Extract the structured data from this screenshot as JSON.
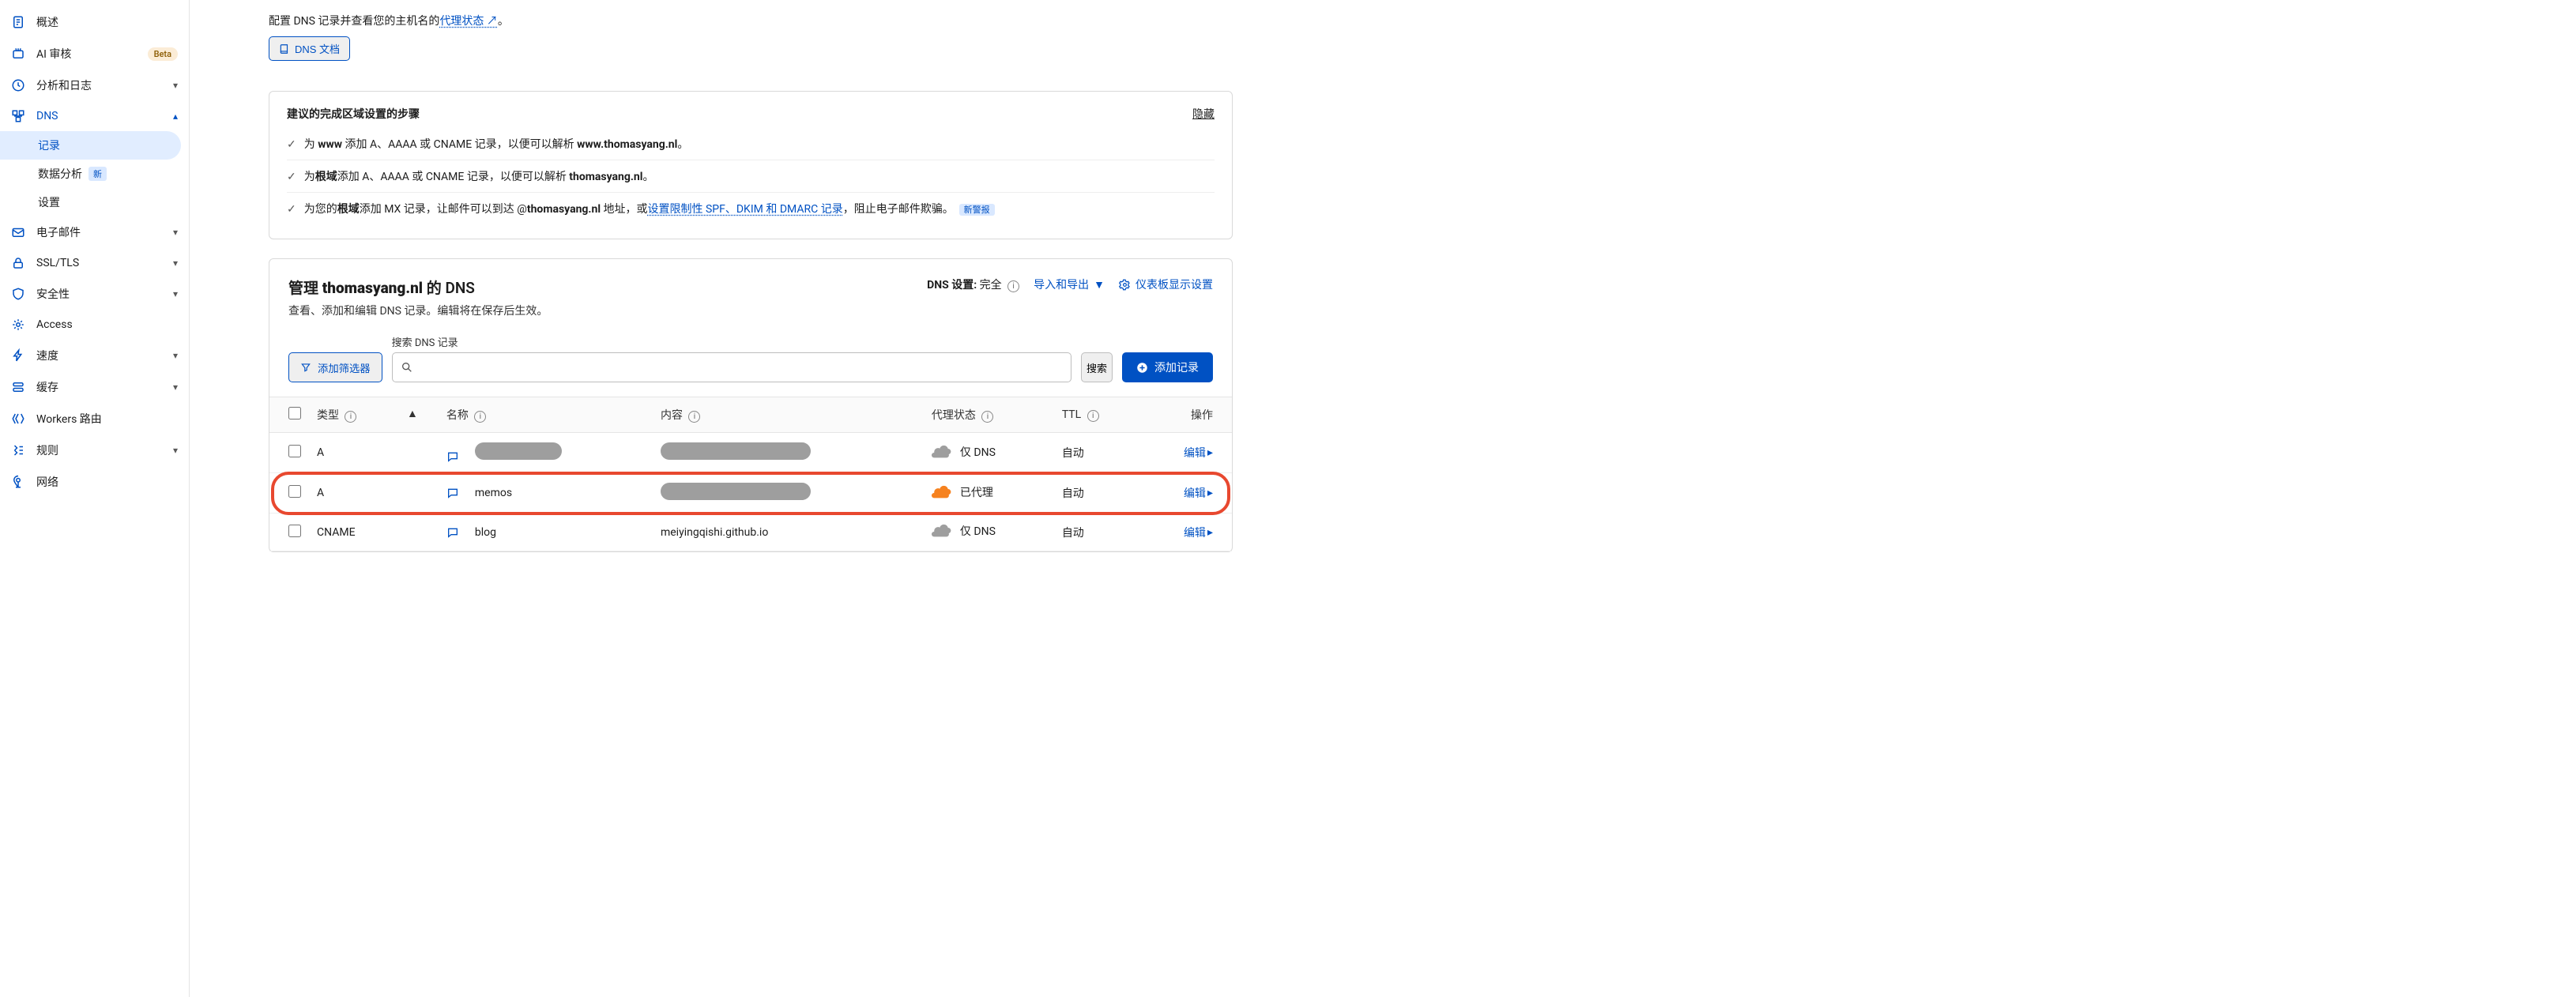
{
  "sidebar": {
    "items": [
      {
        "label": "概述"
      },
      {
        "label": "AI 审核",
        "badge": "Beta"
      },
      {
        "label": "分析和日志",
        "expandable": true
      },
      {
        "label": "DNS",
        "expandable": true,
        "open": true,
        "children": [
          {
            "label": "记录",
            "selected": true
          },
          {
            "label": "数据分析",
            "badge": "新"
          },
          {
            "label": "设置"
          }
        ]
      },
      {
        "label": "电子邮件",
        "expandable": true
      },
      {
        "label": "SSL/TLS",
        "expandable": true
      },
      {
        "label": "安全性",
        "expandable": true
      },
      {
        "label": "Access"
      },
      {
        "label": "速度",
        "expandable": true
      },
      {
        "label": "缓存",
        "expandable": true
      },
      {
        "label": "Workers 路由"
      },
      {
        "label": "规则",
        "expandable": true
      },
      {
        "label": "网络"
      }
    ]
  },
  "intro": {
    "prefix": "配置 DNS 记录并查看您的主机名的",
    "link": "代理状态",
    "suffix": "。",
    "doc_btn": "DNS 文档"
  },
  "steps_panel": {
    "title": "建议的完成区域设置的步骤",
    "hide": "隐藏",
    "steps": [
      {
        "html": "为 <b>www</b> 添加 A、AAAA 或 CNAME 记录，以便可以解析 <b>www.thomasyang.nl</b>。"
      },
      {
        "html": "为<b>根域</b>添加 A、AAAA 或 CNAME 记录，以便可以解析 <b>thomasyang.nl</b>。"
      },
      {
        "html": "为您的<b>根域</b>添加 MX 记录，让邮件可以到达 @<b>thomasyang.nl</b> 地址，或<a class='link'>设置限制性 SPF、DKIM 和 DMARC 记录</a>，阻止电子邮件欺骗。",
        "badge": "新警报"
      }
    ]
  },
  "dns": {
    "title_prefix": "管理 ",
    "domain": "thomasyang.nl",
    "title_suffix": " 的 DNS",
    "subtitle": "查看、添加和编辑 DNS 记录。编辑将在保存后生效。",
    "setting_label": "DNS 设置:",
    "setting_value": "完全",
    "import_export": "导入和导出",
    "dashboard": "仪表板显示设置",
    "search_label": "搜索 DNS 记录",
    "filter_btn": "添加筛选器",
    "search_btn": "搜索",
    "add_btn": "添加记录",
    "columns": {
      "type": "类型",
      "name": "名称",
      "content": "内容",
      "proxy": "代理状态",
      "ttl": "TTL",
      "action": "操作"
    },
    "edit": "编辑",
    "proxy_dns_only": "仅 DNS",
    "proxy_proxied": "已代理",
    "ttl_auto": "自动",
    "rows": [
      {
        "type": "A",
        "name_redacted": true,
        "content_redacted": true,
        "proxy": "dns",
        "ttl": "自动"
      },
      {
        "type": "A",
        "name": "memos",
        "content_redacted": true,
        "proxy": "proxied",
        "ttl": "自动",
        "highlight": true
      },
      {
        "type": "CNAME",
        "name": "blog",
        "content": "meiyingqishi.github.io",
        "proxy": "dns",
        "ttl": "自动"
      }
    ]
  }
}
